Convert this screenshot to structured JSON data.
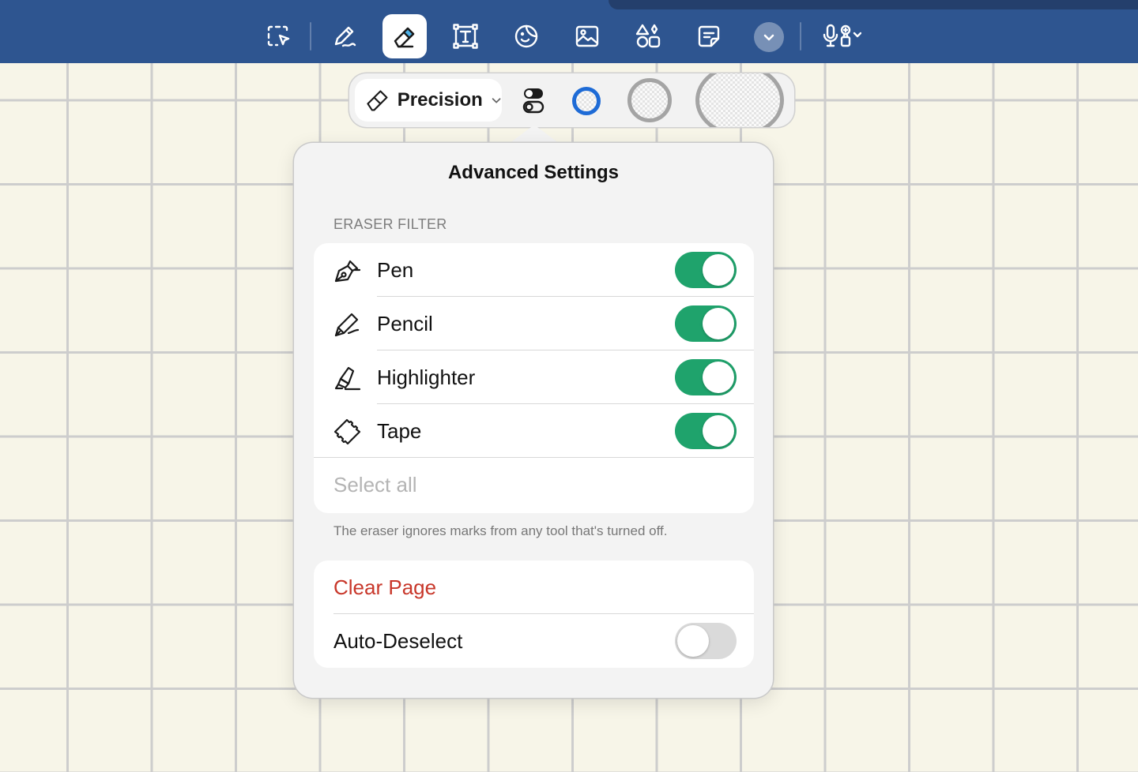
{
  "toolbar": {
    "tools": [
      {
        "name": "lasso-select",
        "active": false
      },
      {
        "name": "pen",
        "active": false
      },
      {
        "name": "eraser",
        "active": true
      },
      {
        "name": "text-box",
        "active": false
      },
      {
        "name": "sticker",
        "active": false
      },
      {
        "name": "image",
        "active": false
      },
      {
        "name": "shapes",
        "active": false
      },
      {
        "name": "sticky-note",
        "active": false
      },
      {
        "name": "more",
        "active": false
      },
      {
        "name": "audio-record",
        "active": false
      }
    ]
  },
  "eraser_options": {
    "mode_label": "Precision"
  },
  "popover": {
    "title": "Advanced Settings",
    "section_header": "ERASER FILTER",
    "filters": [
      {
        "label": "Pen",
        "on": true
      },
      {
        "label": "Pencil",
        "on": true
      },
      {
        "label": "Highlighter",
        "on": true
      },
      {
        "label": "Tape",
        "on": true
      }
    ],
    "select_all": "Select all",
    "footnote": "The eraser ignores marks from any tool that's turned off.",
    "clear_page": "Clear Page",
    "auto_deselect": {
      "label": "Auto-Deselect",
      "on": false
    }
  },
  "colors": {
    "toolbar_bg": "#2e5590",
    "toggle_on": "#1fa36c",
    "danger": "#c8372a",
    "accent_blue": "#1e6bd6"
  }
}
